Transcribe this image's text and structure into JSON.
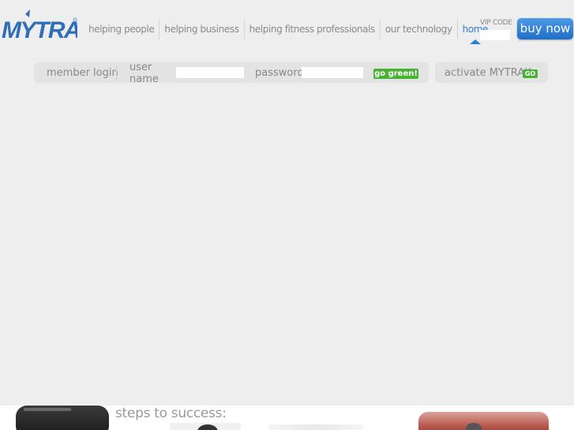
{
  "brand": {
    "name": "MYTRAK",
    "accent": "#2f7fd0",
    "green": "#47b234"
  },
  "nav": {
    "items": [
      {
        "label": "helping people"
      },
      {
        "label": "helping business"
      },
      {
        "label": "helping fitness professionals"
      },
      {
        "label": "our technology"
      },
      {
        "label": "home",
        "active": true
      }
    ]
  },
  "vip": {
    "label": "VIP CODE",
    "value": ""
  },
  "buy_now": {
    "label": "buy now"
  },
  "login": {
    "title": "member login",
    "username_label": "user name",
    "username_value": "",
    "password_label": "password",
    "password_value": "",
    "submit_label": "go green!"
  },
  "activate": {
    "label": "activate MYTRAK",
    "badge": "GO"
  },
  "bottom": {
    "heading": "steps to success:"
  }
}
